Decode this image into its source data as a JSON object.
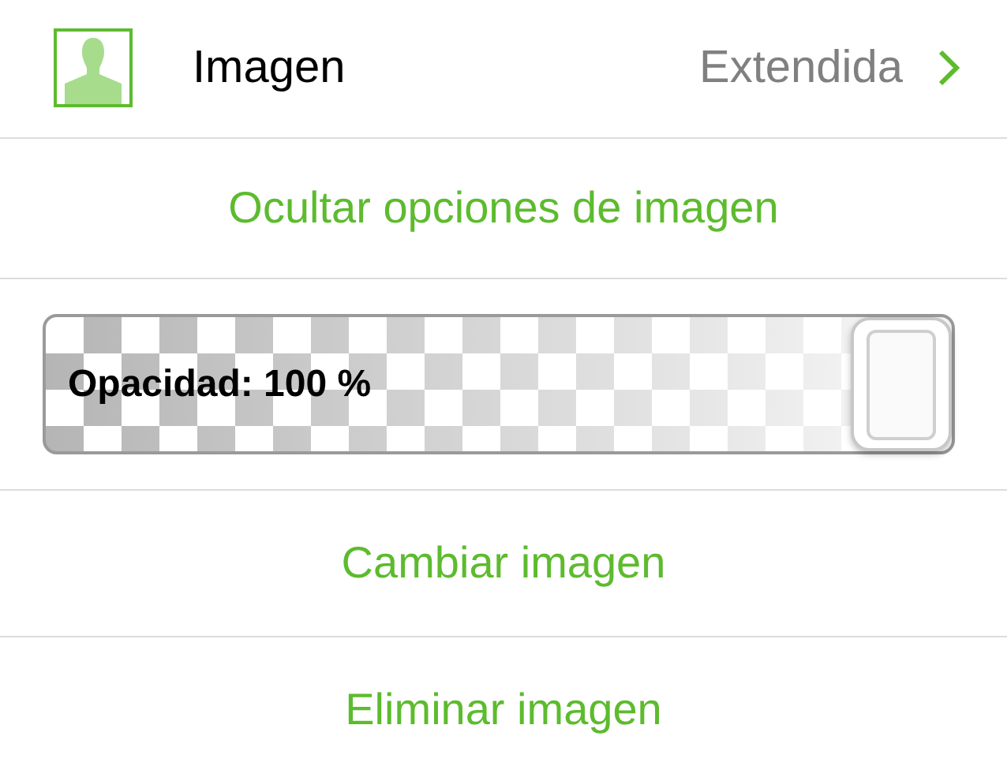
{
  "image_row": {
    "label": "Imagen",
    "value": "Extendida"
  },
  "toggle_action": "Ocultar opciones de imagen",
  "opacity": {
    "label": "Opacidad: 100 %"
  },
  "actions": [
    "Cambiar imagen",
    "Eliminar imagen"
  ]
}
